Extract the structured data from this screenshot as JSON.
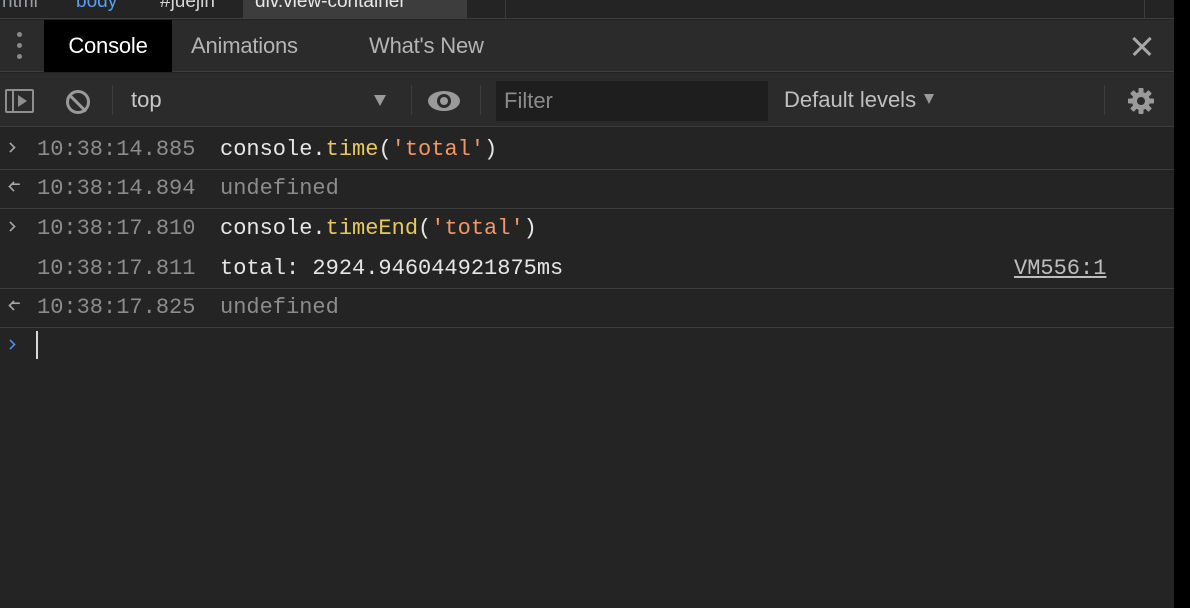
{
  "breadcrumbs": [
    "html",
    "body",
    "#juejin",
    "div.view-container"
  ],
  "drawer": {
    "tabs": [
      "Console",
      "Animations",
      "What's New"
    ],
    "active_tab": "Console"
  },
  "toolbar": {
    "context": "top",
    "filter_placeholder": "Filter",
    "levels_label": "Default levels"
  },
  "messages": [
    {
      "kind": "input",
      "timestamp": "10:38:14.885",
      "obj": "console.",
      "fn": "time",
      "open": "(",
      "str": "'total'",
      "close": ")"
    },
    {
      "kind": "output",
      "timestamp": "10:38:14.894",
      "text": "undefined"
    },
    {
      "kind": "input",
      "timestamp": "10:38:17.810",
      "obj": "console.",
      "fn": "timeEnd",
      "open": "(",
      "str": "'total'",
      "close": ")"
    },
    {
      "kind": "log",
      "timestamp": "10:38:17.811",
      "text": "total: 2924.946044921875ms",
      "source": "VM556:1"
    },
    {
      "kind": "output",
      "timestamp": "10:38:17.825",
      "text": "undefined"
    }
  ],
  "colors": {
    "panel": "#242424",
    "toolbar": "#2b2b2b",
    "function": "#e8c95f",
    "string": "#f29766",
    "prompt": "#4c8ef5"
  }
}
